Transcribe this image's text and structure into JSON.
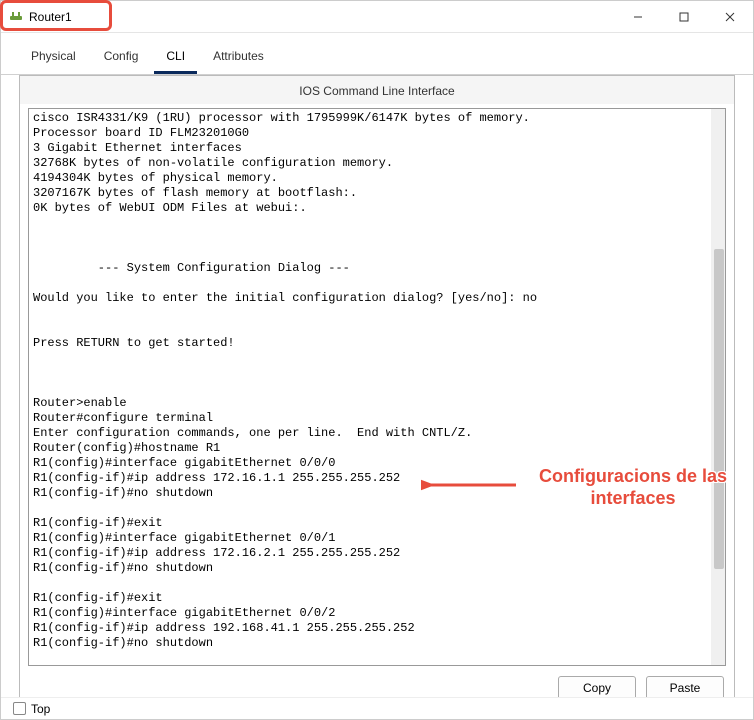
{
  "window": {
    "title": "Router1"
  },
  "tabs": {
    "physical": "Physical",
    "config": "Config",
    "cli": "CLI",
    "attributes": "Attributes"
  },
  "cli": {
    "header": "IOS Command Line Interface",
    "content": "cisco ISR4331/K9 (1RU) processor with 1795999K/6147K bytes of memory.\nProcessor board ID FLM232010G0\n3 Gigabit Ethernet interfaces\n32768K bytes of non-volatile configuration memory.\n4194304K bytes of physical memory.\n3207167K bytes of flash memory at bootflash:.\n0K bytes of WebUI ODM Files at webui:.\n\n\n\n         --- System Configuration Dialog ---\n\nWould you like to enter the initial configuration dialog? [yes/no]: no\n\n\nPress RETURN to get started!\n\n\n\nRouter>enable\nRouter#configure terminal\nEnter configuration commands, one per line.  End with CNTL/Z.\nRouter(config)#hostname R1\nR1(config)#interface gigabitEthernet 0/0/0\nR1(config-if)#ip address 172.16.1.1 255.255.255.252\nR1(config-if)#no shutdown\n\nR1(config-if)#exit\nR1(config)#interface gigabitEthernet 0/0/1\nR1(config-if)#ip address 172.16.2.1 255.255.255.252\nR1(config-if)#no shutdown\n\nR1(config-if)#exit\nR1(config)#interface gigabitEthernet 0/0/2\nR1(config-if)#ip address 192.168.41.1 255.255.255.252\nR1(config-if)#no shutdown"
  },
  "buttons": {
    "copy": "Copy",
    "paste": "Paste"
  },
  "footer": {
    "top": "Top"
  },
  "annotation": {
    "text": "Configuracions de las\ninterfaces"
  }
}
